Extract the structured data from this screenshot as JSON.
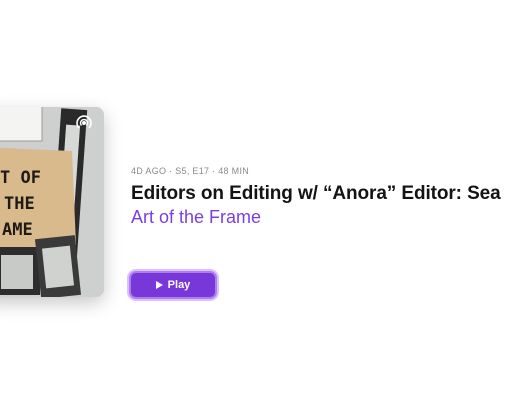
{
  "episode": {
    "meta": "4D AGO · S5, E17 · 48 MIN",
    "title": "Editors on Editing w/ “Anora” Editor: Sea",
    "show": "Art of the Frame"
  },
  "cover": {
    "text_lines": [
      "T OF",
      "THE",
      "AME"
    ],
    "icon": "podcast-icon"
  },
  "actions": {
    "play_label": "Play",
    "play_icon": "play-icon"
  },
  "colors": {
    "accent": "#7837d8",
    "show_link": "#7a3fe0",
    "meta_text": "#8a8a8e",
    "title_text": "#141414"
  }
}
